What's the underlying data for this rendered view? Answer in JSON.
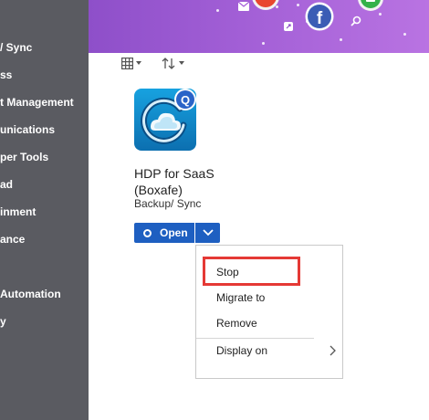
{
  "sidebar": {
    "items": [
      {
        "label": "/ Sync"
      },
      {
        "label": "ss"
      },
      {
        "label": "t Management"
      },
      {
        "label": "unications"
      },
      {
        "label": "per Tools"
      },
      {
        "label": "ad"
      },
      {
        "label": "inment"
      },
      {
        "label": "ance"
      },
      {
        "label": ""
      },
      {
        "label": "Automation"
      },
      {
        "label": "y"
      }
    ]
  },
  "banner": {
    "icons": [
      "mail-icon",
      "facebook-icon",
      "share-icon",
      "search-icon"
    ]
  },
  "toolbar": {
    "view_icon": "grid-view-icon",
    "sort_icon": "sort-icon"
  },
  "app": {
    "name": "HDP for SaaS (Boxafe)",
    "category": "Backup/ Sync",
    "badge": "Q",
    "open_label": "Open"
  },
  "context_menu": {
    "items": [
      "Stop",
      "Migrate to",
      "Remove",
      "Display on"
    ]
  },
  "colors": {
    "sidebar": "#5a5b61",
    "primary_button": "#1e5fc1",
    "highlight": "#e53935",
    "banner_start": "#8e4fc9",
    "banner_end": "#b973e2"
  }
}
